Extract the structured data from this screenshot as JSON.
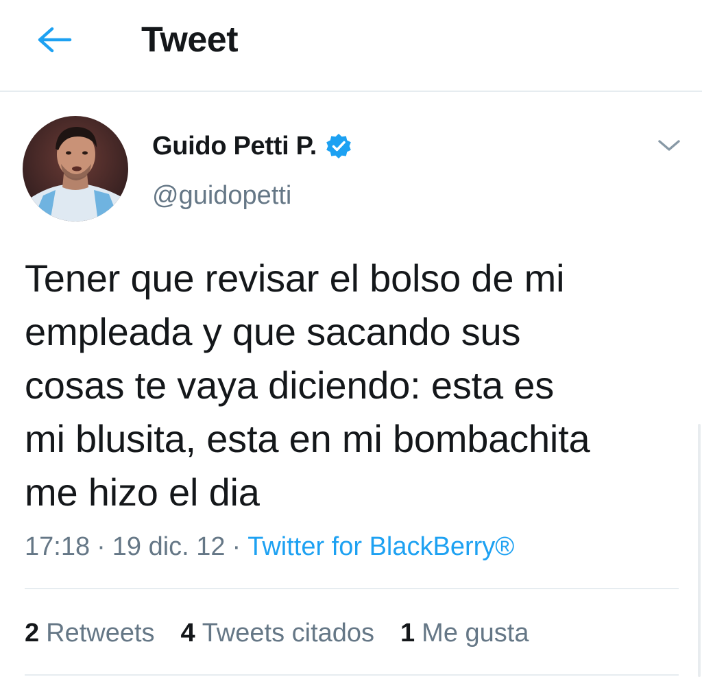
{
  "header": {
    "back_icon": "arrow-left-icon",
    "title": "Tweet"
  },
  "tweet": {
    "avatar_icon": "avatar-photo",
    "author_name": "Guido Petti P.",
    "verified_icon": "verified-badge-icon",
    "handle": "@guidopetti",
    "more_icon": "chevron-down-icon",
    "text_lines": [
      "Tener que revisar el bolso de mi",
      "empleada y que sacando sus",
      "cosas te vaya diciendo: esta es",
      "mi blusita, esta en mi bombachita",
      "me hizo el dia"
    ],
    "time": "17:18",
    "date": "19 dic. 12",
    "separator": "·",
    "source": "Twitter for BlackBerry®"
  },
  "stats": {
    "retweets_count": "2",
    "retweets_label": "Retweets",
    "quotes_count": "4",
    "quotes_label": "Tweets citados",
    "likes_count": "1",
    "likes_label": "Me gusta"
  },
  "colors": {
    "accent": "#1da1f2",
    "text": "#14171a",
    "secondary": "#657786",
    "divider": "#e6ecf0"
  }
}
